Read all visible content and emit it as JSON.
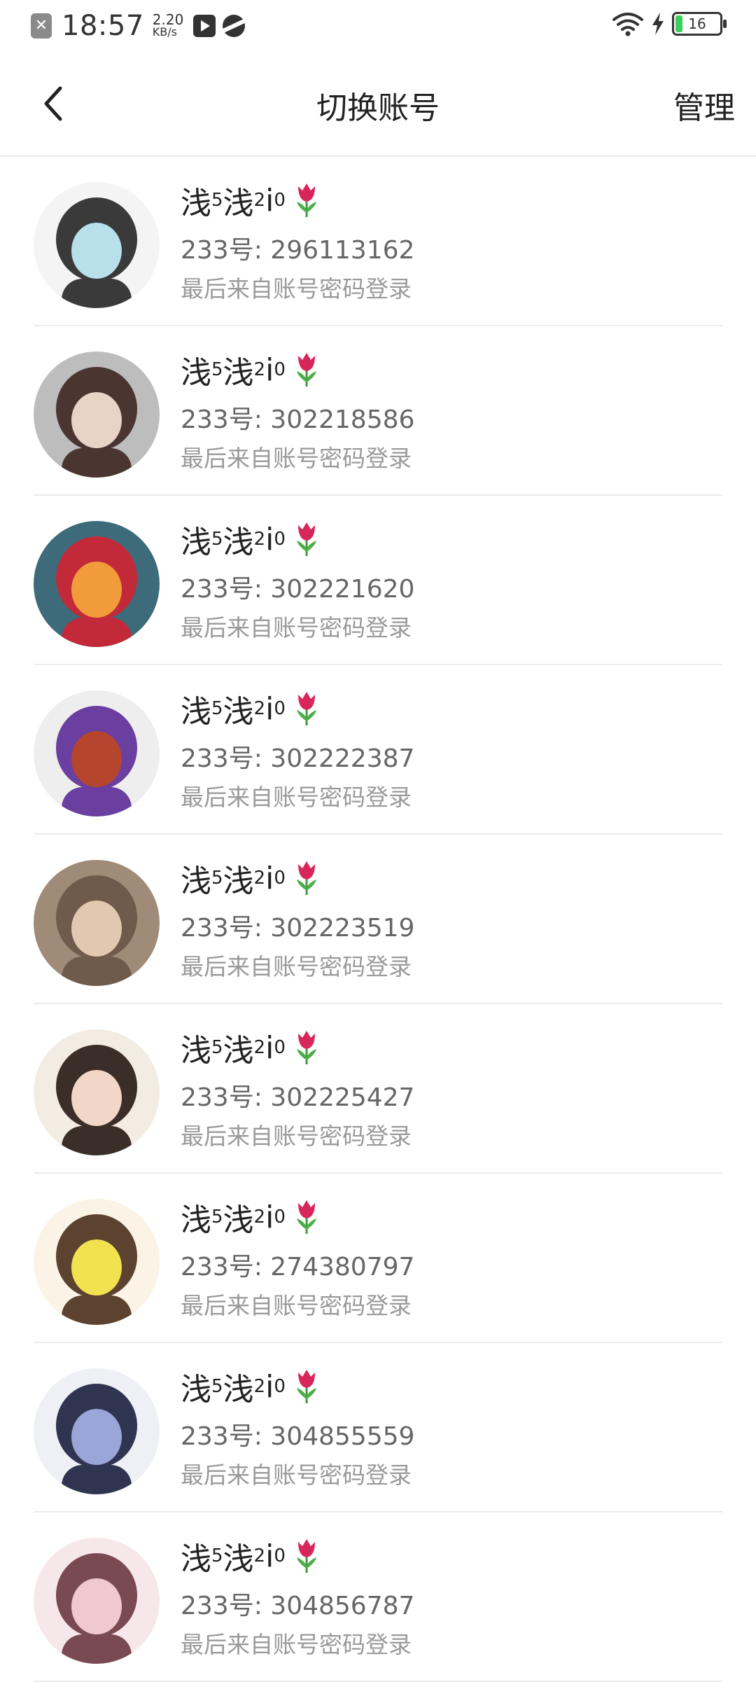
{
  "status_bar": {
    "time": "18:57",
    "net_speed_value": "2.20",
    "net_speed_unit": "KB/s",
    "battery": "16",
    "battery_level": 0.16,
    "icons": [
      "notification-x-icon",
      "play-icon",
      "planet-icon",
      "wifi-icon",
      "charging-bolt-icon",
      "battery-icon"
    ]
  },
  "header": {
    "title": "切换账号",
    "manage_label": "管理",
    "back_icon": "chevron-left-icon"
  },
  "accounts": [
    {
      "name_a": "浅",
      "sup_a": "5",
      "name_b": "浅",
      "sup_b": "2",
      "name_c": "i",
      "sup_c": "0",
      "uid": "233号: 296113162",
      "login": "最后来自账号密码登录",
      "avatar_colors": [
        "#f4f4f4",
        "#3a3a3a",
        "#b8e0ea"
      ]
    },
    {
      "name_a": "浅",
      "sup_a": "5",
      "name_b": "浅",
      "sup_b": "2",
      "name_c": "i",
      "sup_c": "0",
      "uid": "233号: 302218586",
      "login": "最后来自账号密码登录",
      "avatar_colors": [
        "#bdbdbd",
        "#4a3530",
        "#e9d2c6"
      ]
    },
    {
      "name_a": "浅",
      "sup_a": "5",
      "name_b": "浅",
      "sup_b": "2",
      "name_c": "i",
      "sup_c": "0",
      "uid": "233号: 302221620",
      "login": "最后来自账号密码登录",
      "avatar_colors": [
        "#3d6b7a",
        "#c22a3a",
        "#f29b3b"
      ]
    },
    {
      "name_a": "浅",
      "sup_a": "5",
      "name_b": "浅",
      "sup_b": "2",
      "name_c": "i",
      "sup_c": "0",
      "uid": "233号: 302222387",
      "login": "最后来自账号密码登录",
      "avatar_colors": [
        "#eeeeee",
        "#6a3fa0",
        "#b6452d"
      ]
    },
    {
      "name_a": "浅",
      "sup_a": "5",
      "name_b": "浅",
      "sup_b": "2",
      "name_c": "i",
      "sup_c": "0",
      "uid": "233号: 302223519",
      "login": "最后来自账号密码登录",
      "avatar_colors": [
        "#a08a78",
        "#6f5a4c",
        "#e2c8b0"
      ]
    },
    {
      "name_a": "浅",
      "sup_a": "5",
      "name_b": "浅",
      "sup_b": "2",
      "name_c": "i",
      "sup_c": "0",
      "uid": "233号: 302225427",
      "login": "最后来自账号密码登录",
      "avatar_colors": [
        "#f3ece3",
        "#3b2e28",
        "#f2d6c8"
      ]
    },
    {
      "name_a": "浅",
      "sup_a": "5",
      "name_b": "浅",
      "sup_b": "2",
      "name_c": "i",
      "sup_c": "0",
      "uid": "233号: 274380797",
      "login": "最后来自账号密码登录",
      "avatar_colors": [
        "#fbf3e6",
        "#5b4330",
        "#f3e24f"
      ]
    },
    {
      "name_a": "浅",
      "sup_a": "5",
      "name_b": "浅",
      "sup_b": "2",
      "name_c": "i",
      "sup_c": "0",
      "uid": "233号: 304855559",
      "login": "最后来自账号密码登录",
      "avatar_colors": [
        "#eef0f6",
        "#2f3450",
        "#9aa6d8"
      ]
    },
    {
      "name_a": "浅",
      "sup_a": "5",
      "name_b": "浅",
      "sup_b": "2",
      "name_c": "i",
      "sup_c": "0",
      "uid": "233号: 304856787",
      "login": "最后来自账号密码登录",
      "avatar_colors": [
        "#f6e8ea",
        "#7a4a52",
        "#f0c9cf"
      ]
    }
  ]
}
